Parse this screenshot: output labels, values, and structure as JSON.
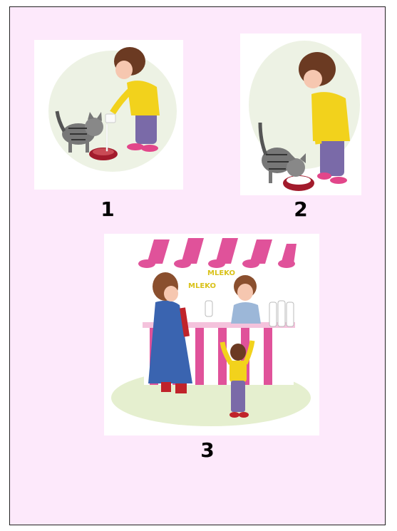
{
  "panels": [
    {
      "label": "1"
    },
    {
      "label": "2"
    },
    {
      "label": "3"
    }
  ],
  "shop": {
    "sign_top": "MLEKO",
    "sign_left": "MLEKO"
  },
  "colors": {
    "page_bg": "#fde9fb",
    "awning_pink": "#e0529a",
    "sweater_yellow": "#f2d21c",
    "pants_purple": "#7a6aa8",
    "hair_brown": "#6b3a22",
    "coat_blue": "#3a64b0"
  }
}
